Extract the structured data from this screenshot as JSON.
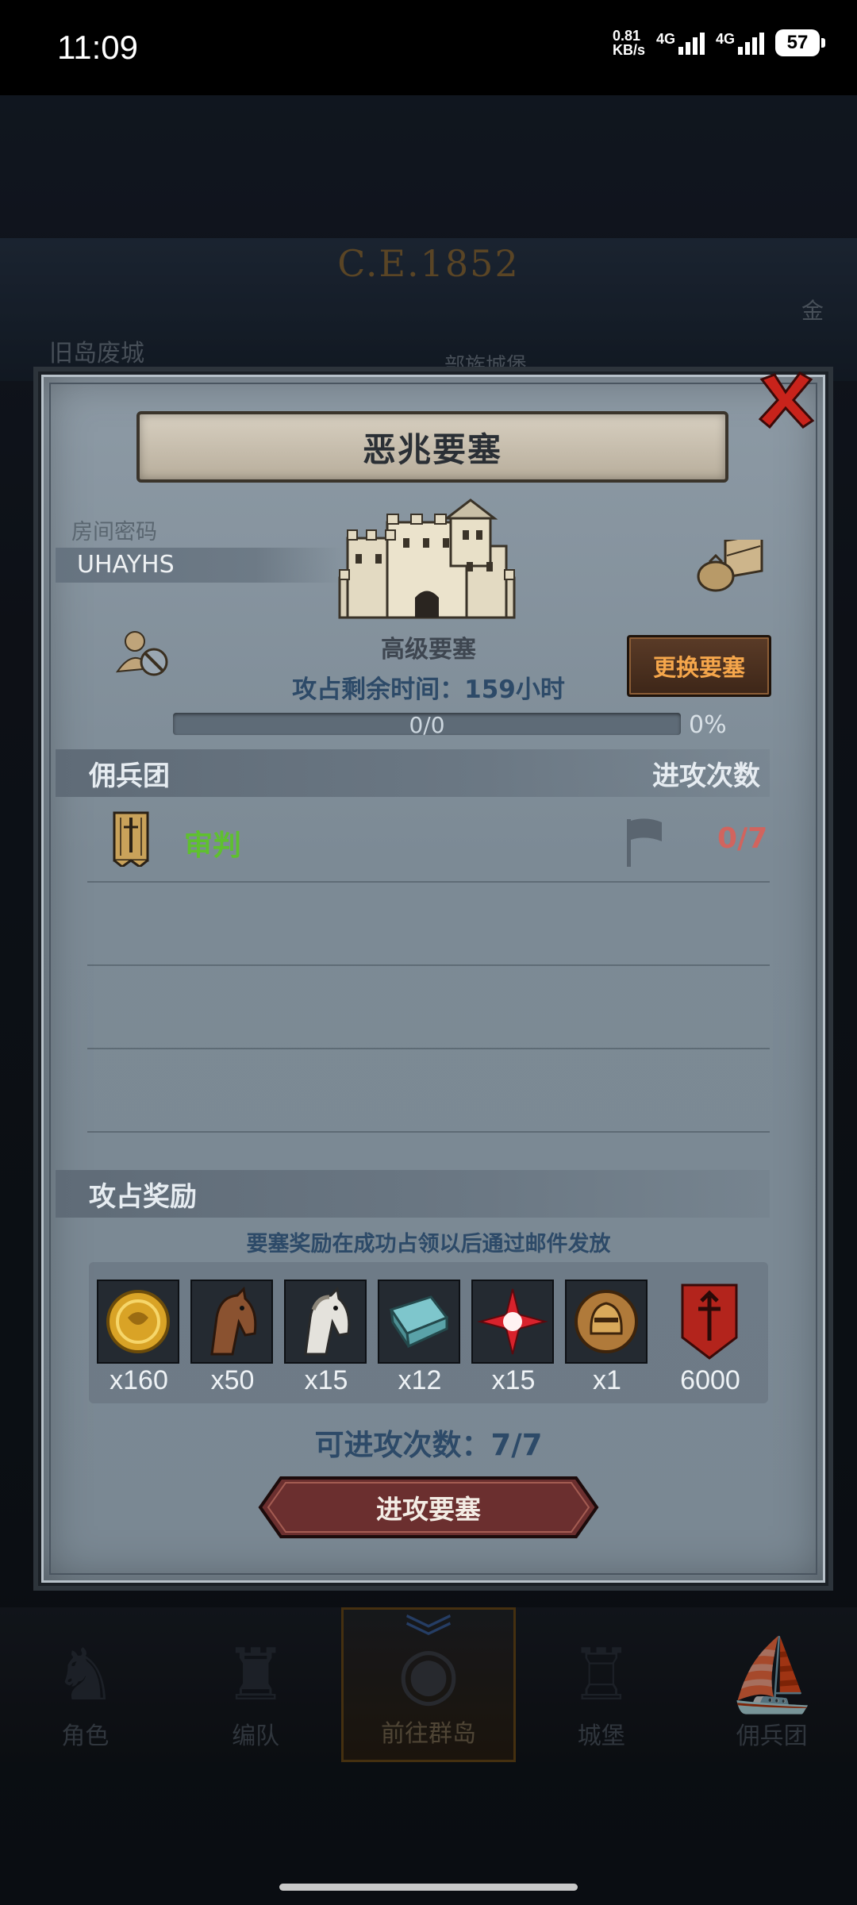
{
  "status_bar": {
    "time": "11:09",
    "net_speed_top": "0.81",
    "net_speed_bottom": "KB/s",
    "sim1": "4G",
    "sim2": "4G",
    "battery": "57"
  },
  "background": {
    "year": "C.E.1852",
    "location_left": "旧岛废城",
    "location_mid": "部族城堡",
    "right_tab": "金"
  },
  "dialog": {
    "title": "恶兆要塞",
    "close_icon": "close-x-icon",
    "room_password_label": "房间密码",
    "room_password_value": "UHAYHS",
    "fortress_level": "高级要塞",
    "change_fortress_button": "更换要塞",
    "remaining_time": "攻占剩余时间：159小时",
    "progress_text": "0/0",
    "progress_percent": "0%",
    "progress_fraction": 0,
    "mercenary_header": "佣兵团",
    "attack_count_header": "进攻次数",
    "mercenaries": [
      {
        "name": "审判",
        "attacks": "0/7"
      }
    ],
    "rewards_header": "攻占奖励",
    "rewards_note": "要塞奖励在成功占领以后通过邮件发放",
    "rewards": [
      {
        "icon": "gold-coin-icon",
        "qty": "x160"
      },
      {
        "icon": "brown-horse-icon",
        "qty": "x50"
      },
      {
        "icon": "white-horse-icon",
        "qty": "x15"
      },
      {
        "icon": "cloth-bolt-icon",
        "qty": "x12"
      },
      {
        "icon": "red-star-icon",
        "qty": "x15"
      },
      {
        "icon": "helmet-medal-icon",
        "qty": "x1"
      },
      {
        "icon": "red-banner-icon",
        "qty": "6000"
      }
    ],
    "attacks_available": "可进攻次数：7/7",
    "attack_button": "进攻要塞"
  },
  "bottom_nav": [
    {
      "label": "角色",
      "icon": "knight-icon"
    },
    {
      "label": "编队",
      "icon": "squad-icon"
    },
    {
      "label": "前往群岛",
      "icon": "globe-icon"
    },
    {
      "label": "城堡",
      "icon": "castle-icon"
    },
    {
      "label": "佣兵团",
      "icon": "ship-icon"
    }
  ]
}
